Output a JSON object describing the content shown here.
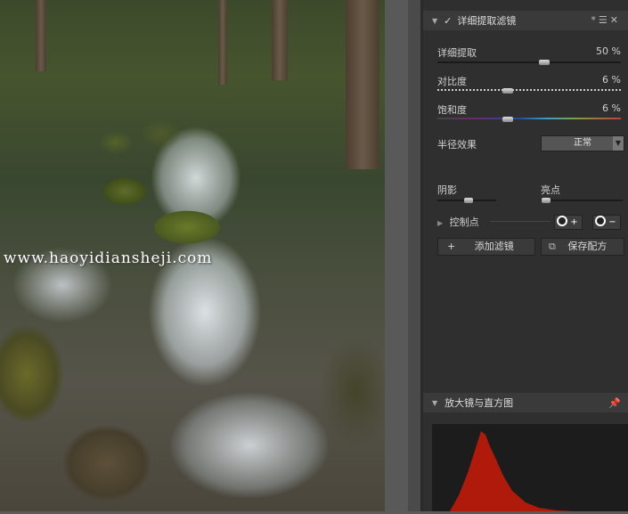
{
  "photo": {
    "watermark": "www.haoyidiansheji.com"
  },
  "panel": {
    "filter_title": "详细提取滤镜",
    "header_icons": "*☰✕",
    "sliders": [
      {
        "label": "详细提取",
        "value": "50 %"
      },
      {
        "label": "对比度",
        "value": "6 %"
      },
      {
        "label": "饱和度",
        "value": "6 %"
      }
    ],
    "radius_label": "半径效果",
    "radius_value": "正常",
    "shadows_label": "阴影",
    "highlights_label": "亮点",
    "control_points_label": "控制点",
    "add_filter_label": "添加滤镜",
    "add_filter_icon": "+",
    "save_recipe_label": "保存配方",
    "loupe_title": "放大镜与直方图"
  }
}
